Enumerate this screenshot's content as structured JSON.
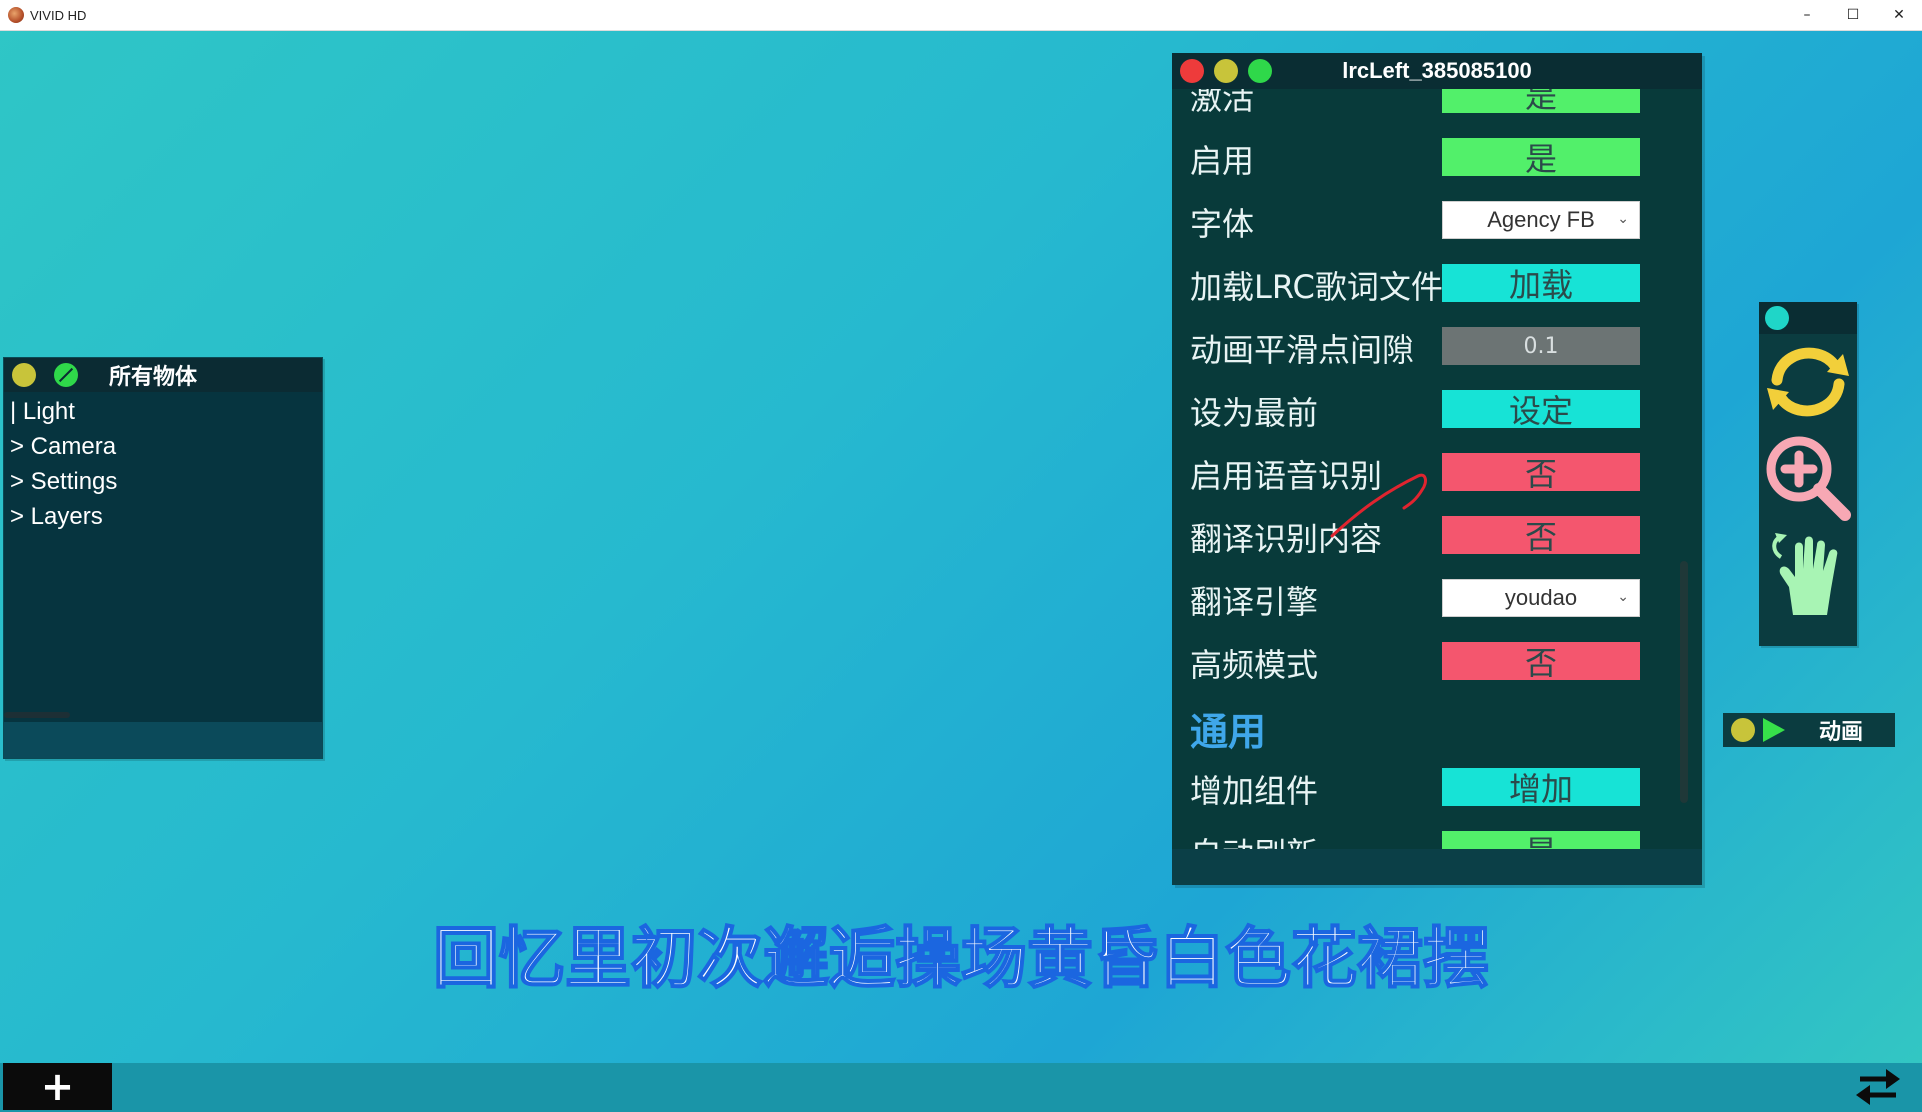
{
  "window": {
    "title": "VIVID HD",
    "minimize": "–",
    "maximize": "☐",
    "close": "✕"
  },
  "hierarchy": {
    "title": "所有物体",
    "items": [
      "| Light",
      "> Camera",
      "> Settings",
      "> Layers"
    ]
  },
  "inspector": {
    "title": "lrcLeft_385085100",
    "rows": [
      {
        "label": "激活",
        "value": "是",
        "style": "green"
      },
      {
        "label": "启用",
        "value": "是",
        "style": "green"
      },
      {
        "label": "字体",
        "value": "Agency FB",
        "style": "select"
      },
      {
        "label": "加载LRC歌词文件",
        "value": "加载",
        "style": "cyan"
      },
      {
        "label": "动画平滑点间隙",
        "value": "0.1",
        "style": "gray"
      },
      {
        "label": "设为最前",
        "value": "设定",
        "style": "cyan"
      },
      {
        "label": "启用语音识别",
        "value": "否",
        "style": "red"
      },
      {
        "label": "翻译识别内容",
        "value": "否",
        "style": "red"
      },
      {
        "label": "翻译引擎",
        "value": "youdao",
        "style": "select"
      },
      {
        "label": "高频模式",
        "value": "否",
        "style": "red"
      }
    ],
    "section": "通用",
    "rows2": [
      {
        "label": "增加组件",
        "value": "增加",
        "style": "cyan"
      },
      {
        "label": "自动刷新",
        "value": "是",
        "style": "green"
      }
    ]
  },
  "tools": {
    "items": [
      "refresh-icon",
      "zoom-in-icon",
      "hand-icon"
    ]
  },
  "animation": {
    "label": "动画"
  },
  "lyric": {
    "text": "回忆里初次邂逅操场黄昏白色花裙摆"
  },
  "bottombar": {
    "add_label": "+"
  },
  "colors": {
    "green": "#52f06a",
    "cyan": "#17e3d6",
    "red": "#f4566e",
    "section_blue": "#3fa7ea"
  }
}
